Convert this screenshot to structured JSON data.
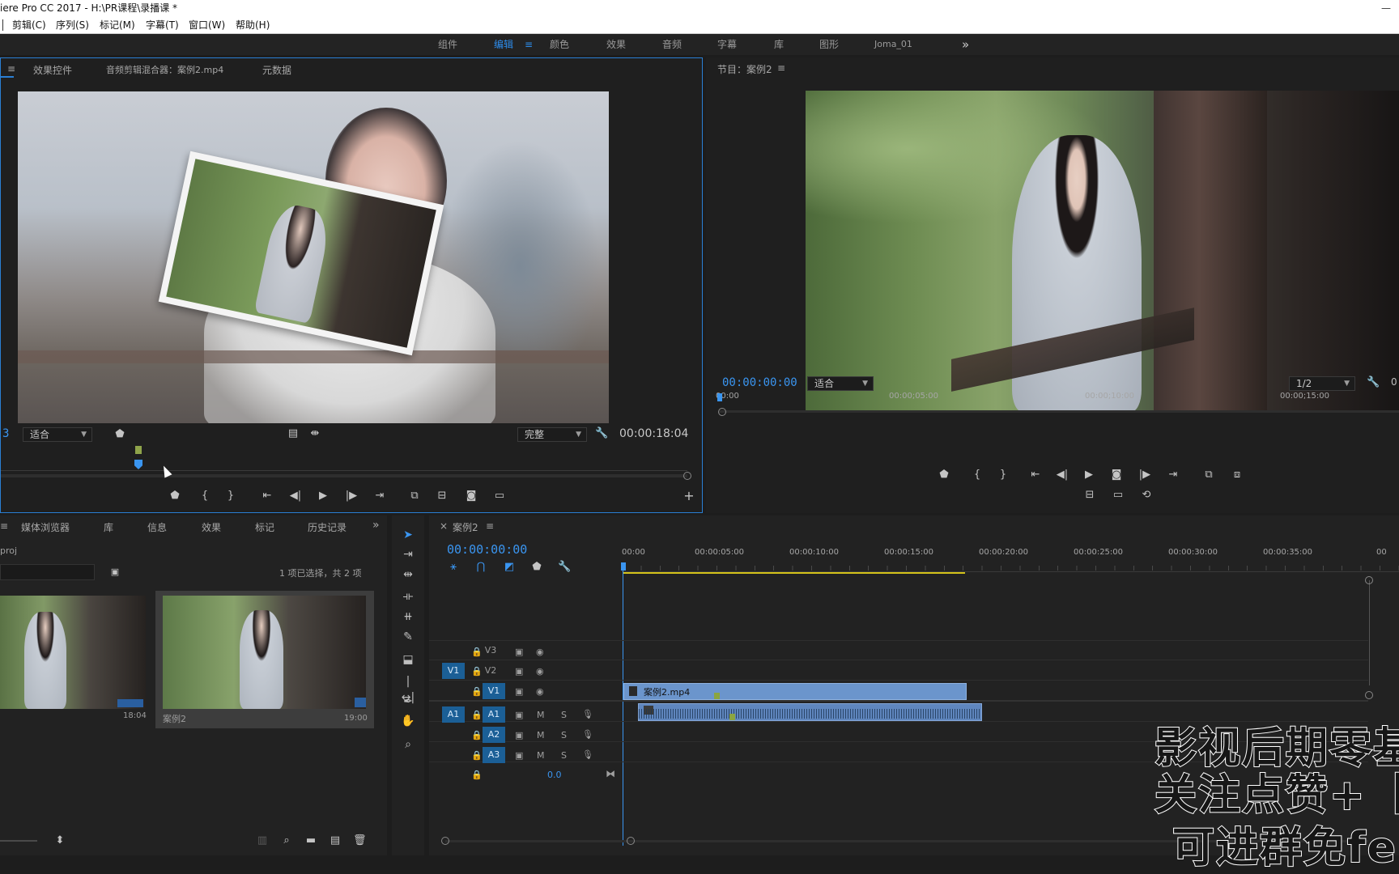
{
  "titlebar": {
    "title": "iere Pro CC 2017 - H:\\PR课程\\录播课 *",
    "minimize": "—"
  },
  "menu": [
    "剪辑(C)",
    "序列(S)",
    "标记(M)",
    "字幕(T)",
    "窗口(W)",
    "帮助(H)"
  ],
  "workspaces": {
    "items": [
      "组件",
      "编辑",
      "颜色",
      "效果",
      "音频",
      "字幕",
      "库",
      "图形",
      "Joma_01"
    ],
    "active": "编辑",
    "more": "»",
    "menu_icon": "≡"
  },
  "source_panel": {
    "menu_icon": "≡",
    "tabs": [
      "效果控件",
      "音频剪辑混合器：案例2.mp4",
      "元数据"
    ],
    "left_timecode": "3",
    "fit_select": "适合",
    "quality_select": "完整",
    "duration": "00:00:18:04"
  },
  "program_panel": {
    "title": "节目：案例2",
    "menu_icon": "≡",
    "timecode": "00:00:00:00",
    "fit_select": "适合",
    "resolution_select": "1/2",
    "right_partial": "0",
    "ruler": [
      "00:00",
      "00:00;05:00",
      "00:00;10:00",
      "00:00;15:00"
    ]
  },
  "project_panel": {
    "tabs": [
      "媒体浏览器",
      "库",
      "信息",
      "效果",
      "标记",
      "历史记录"
    ],
    "more": "»",
    "proj_name": "proj",
    "selection_info": "1 项已选择，共 2 项",
    "items": [
      {
        "name": "",
        "duration": "18:04"
      },
      {
        "name": "案例2",
        "duration": "19:00"
      }
    ]
  },
  "timeline": {
    "close": "×",
    "sequence_name": "案例2",
    "menu_icon": "≡",
    "timecode": "00:00:00:00",
    "ruler": [
      "00:00",
      "00:00:05:00",
      "00:00:10:00",
      "00:00:15:00",
      "00:00:20:00",
      "00:00:25:00",
      "00:00:30:00",
      "00:00:35:00",
      "00"
    ],
    "video_tracks": [
      "V3",
      "V2",
      "V1"
    ],
    "audio_tracks": [
      "A1",
      "A2",
      "A3"
    ],
    "source_patch_video": "V1",
    "source_patch_audio": "A1",
    "mute": "M",
    "solo": "S",
    "master_volume": "0.0",
    "clip_name": "案例2.mp4"
  },
  "overlay": {
    "line1": "影视后期零基础",
    "line2": "关注点赞+［主",
    "line3": "可进群免fei领"
  },
  "colors": {
    "accent": "#2d8ceb",
    "video_clip": "#6b95cc",
    "audio_clip": "#5f86be",
    "track_patch": "#1b5f96"
  }
}
